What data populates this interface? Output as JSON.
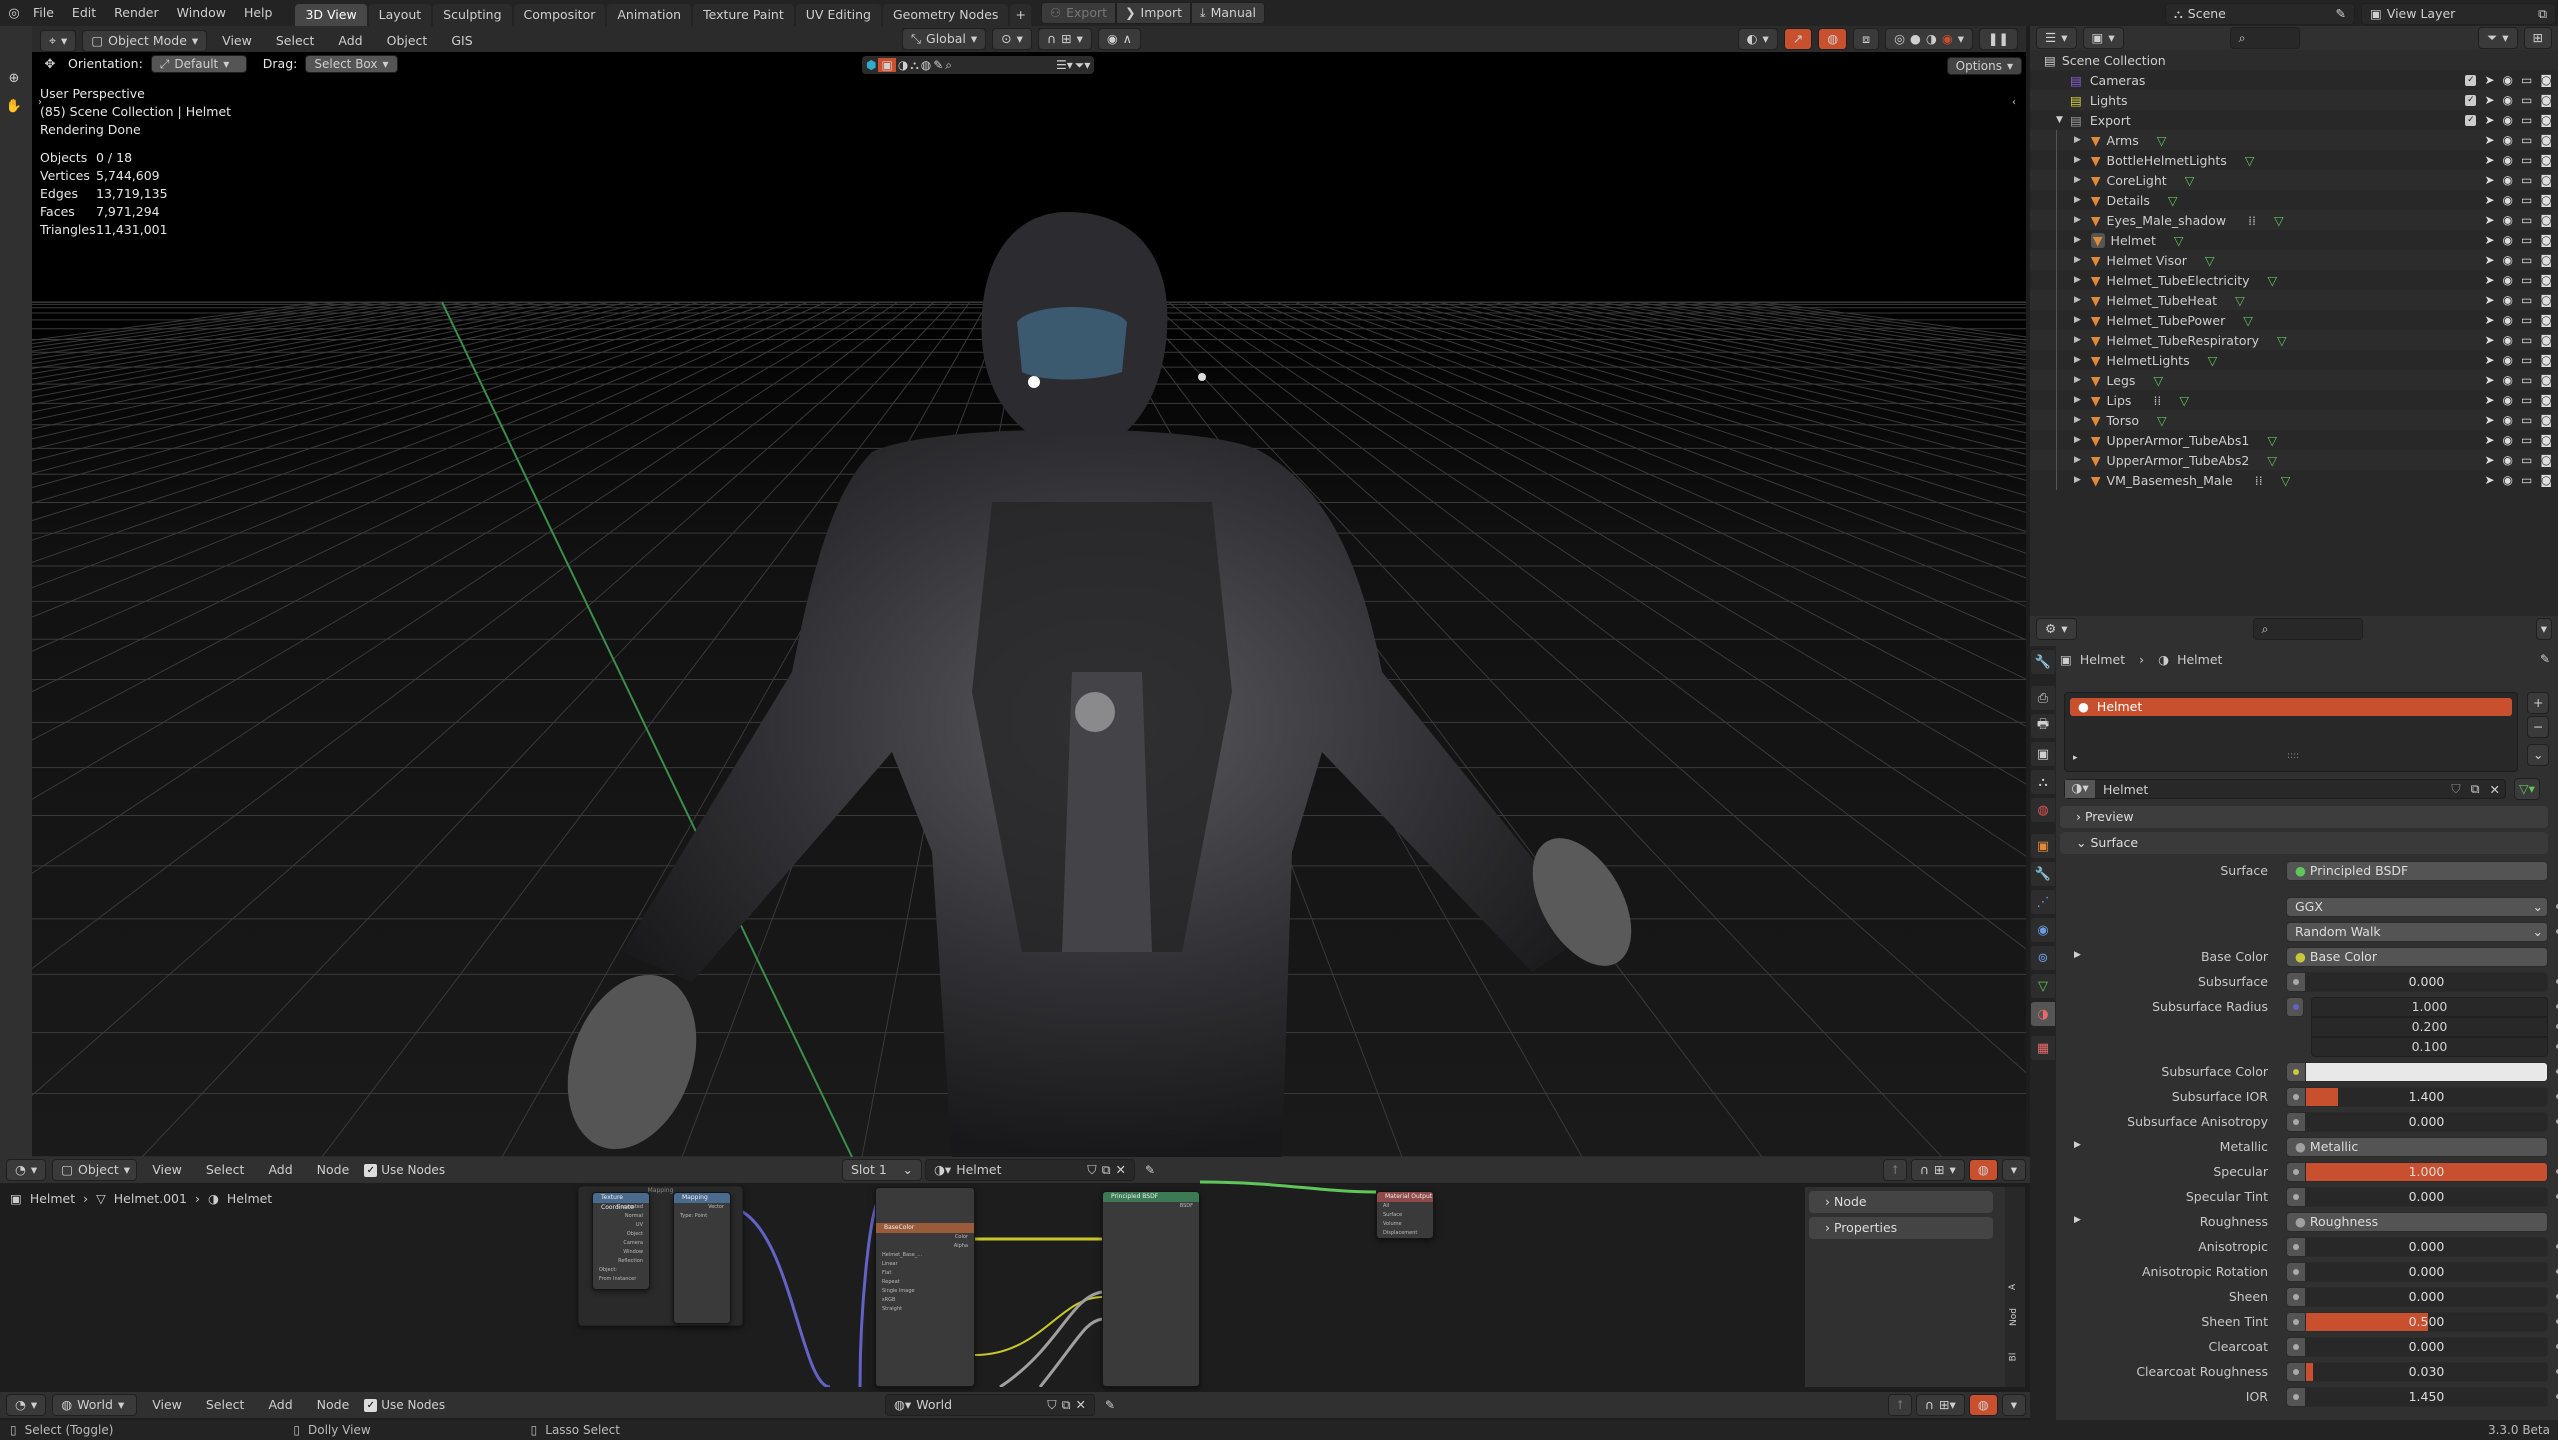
{
  "topbar": {
    "menus": [
      "File",
      "Edit",
      "Render",
      "Window",
      "Help"
    ],
    "workspaces": [
      "3D View",
      "Layout",
      "Sculpting",
      "Compositor",
      "Animation",
      "Texture Paint",
      "UV Editing",
      "Geometry Nodes"
    ],
    "active_workspace": "3D View",
    "add_tab": "+",
    "export_label": "Export",
    "import_label": "Import",
    "manual_label": "Manual",
    "scene_label": "Scene",
    "view_layer_label": "View Layer"
  },
  "viewport_header": {
    "mode": "Object Mode",
    "menus": [
      "View",
      "Select",
      "Add",
      "Object",
      "GIS"
    ],
    "transform_orientation": "Global",
    "orientation_label": "Orientation:",
    "orientation_value": "Default",
    "drag_label": "Drag:",
    "drag_value": "Select Box",
    "options_label": "Options"
  },
  "viewport": {
    "view_name": "User Perspective",
    "collection_info": "(85) Scene Collection | Helmet",
    "render_status": "Rendering Done",
    "stats": [
      {
        "label": "Objects",
        "value": "0 / 18"
      },
      {
        "label": "Vertices",
        "value": "5,744,609"
      },
      {
        "label": "Edges",
        "value": "13,719,135"
      },
      {
        "label": "Faces",
        "value": "7,971,294"
      },
      {
        "label": "Triangles",
        "value": "11,431,001"
      }
    ]
  },
  "outliner": {
    "root": "Scene Collection",
    "collections": [
      {
        "name": "Cameras",
        "color": "#8a5cd6"
      },
      {
        "name": "Lights",
        "color": "#d8d03a"
      },
      {
        "name": "Export",
        "color": "#9a9a9a"
      }
    ],
    "objects": [
      {
        "name": "Arms",
        "extra": false
      },
      {
        "name": "BottleHelmetLights",
        "extra": false
      },
      {
        "name": "CoreLight",
        "extra": false
      },
      {
        "name": "Details",
        "extra": false
      },
      {
        "name": "Eyes_Male_shadow",
        "extra": true
      },
      {
        "name": "Helmet",
        "extra": false,
        "active": true
      },
      {
        "name": "Helmet Visor",
        "extra": false
      },
      {
        "name": "Helmet_TubeElectricity",
        "extra": false
      },
      {
        "name": "Helmet_TubeHeat",
        "extra": false
      },
      {
        "name": "Helmet_TubePower",
        "extra": false
      },
      {
        "name": "Helmet_TubeRespiratory",
        "extra": false
      },
      {
        "name": "HelmetLights",
        "extra": false
      },
      {
        "name": "Legs",
        "extra": false
      },
      {
        "name": "Lips",
        "extra": true
      },
      {
        "name": "Torso",
        "extra": false
      },
      {
        "name": "UpperArmor_TubeAbs1",
        "extra": false
      },
      {
        "name": "UpperArmor_TubeAbs2",
        "extra": false
      },
      {
        "name": "VM_Basemesh_Male",
        "extra": true
      }
    ]
  },
  "properties": {
    "breadcrumb_object": "Helmet",
    "breadcrumb_material": "Helmet",
    "material_slot": "Helmet",
    "material_name": "Helmet",
    "panels": {
      "preview": "Preview",
      "surface": "Surface"
    },
    "surface_label": "Surface",
    "surface_value": "Principled BSDF",
    "distribution": "GGX",
    "subsurface_method": "Random Walk",
    "fields": [
      {
        "label": "Base Color",
        "type": "link",
        "value": "Base Color",
        "socket": "#c8c83a"
      },
      {
        "label": "Subsurface",
        "type": "slider",
        "value": "0.000",
        "fraction": 0
      },
      {
        "label": "Subsurface Radius",
        "type": "vector",
        "values": [
          "1.000",
          "0.200",
          "0.100"
        ]
      },
      {
        "label": "Subsurface Color",
        "type": "color",
        "color": "#e8e8e8"
      },
      {
        "label": "Subsurface IOR",
        "type": "slider",
        "value": "1.400",
        "fraction": 0.13
      },
      {
        "label": "Subsurface Anisotropy",
        "type": "slider",
        "value": "0.000",
        "fraction": 0
      },
      {
        "label": "Metallic",
        "type": "link",
        "value": "Metallic",
        "socket": "#a0a0a0"
      },
      {
        "label": "Specular",
        "type": "slider",
        "value": "1.000",
        "fraction": 1
      },
      {
        "label": "Specular Tint",
        "type": "slider",
        "value": "0.000",
        "fraction": 0
      },
      {
        "label": "Roughness",
        "type": "link",
        "value": "Roughness",
        "socket": "#a0a0a0"
      },
      {
        "label": "Anisotropic",
        "type": "slider",
        "value": "0.000",
        "fraction": 0
      },
      {
        "label": "Anisotropic Rotation",
        "type": "slider",
        "value": "0.000",
        "fraction": 0
      },
      {
        "label": "Sheen",
        "type": "slider",
        "value": "0.000",
        "fraction": 0
      },
      {
        "label": "Sheen Tint",
        "type": "slider",
        "value": "0.500",
        "fraction": 0.5
      },
      {
        "label": "Clearcoat",
        "type": "slider",
        "value": "0.000",
        "fraction": 0
      },
      {
        "label": "Clearcoat Roughness",
        "type": "slider",
        "value": "0.030",
        "fraction": 0.03
      },
      {
        "label": "IOR",
        "type": "slider",
        "value": "1.450",
        "fraction": 0
      }
    ]
  },
  "node_editor": {
    "type_value": "Object",
    "menus": [
      "View",
      "Select",
      "Add",
      "Node"
    ],
    "use_nodes_label": "Use Nodes",
    "slot": "Slot 1",
    "material": "Helmet",
    "breadcrumb": [
      "Helmet",
      "Helmet.001",
      "Helmet"
    ],
    "sidebar_panels": [
      "Node",
      "Properties"
    ],
    "sidebar_tabs": [
      "A",
      "Nod",
      "Bl"
    ],
    "nodes": {
      "texcoord": {
        "title": "Texture Coordinate",
        "outputs": [
          "Generated",
          "Normal",
          "UV",
          "Object",
          "Camera",
          "Window",
          "Reflection"
        ],
        "object_label": "Object:",
        "from_instancer": "From Instancer"
      },
      "mapping": {
        "title": "Mapping",
        "output": "Vector",
        "type_label": "Type:",
        "type_value": "Point",
        "inputs": [
          "Vector",
          "Location",
          "Rotation",
          "Scale"
        ]
      },
      "frame_label": "Mapping",
      "base_color": {
        "title": "BaseColor",
        "outputs": [
          "Color",
          "Alpha"
        ],
        "image": "Helmet_Base_...",
        "interp": "Linear",
        "proj": "Flat",
        "ext": "Repeat",
        "source": "Single Image",
        "colorspace": "sRGB",
        "alpha": "Straight"
      },
      "bsdf": {
        "title": "Principled BSDF",
        "output": "BSDF"
      },
      "output": {
        "title": "Material Output",
        "target": "All",
        "inputs": [
          "Surface",
          "Volume",
          "Displacement"
        ]
      }
    }
  },
  "world_editor": {
    "type_value": "World",
    "menus": [
      "View",
      "Select",
      "Add",
      "Node"
    ],
    "use_nodes_label": "Use Nodes",
    "world": "World"
  },
  "status_bar": {
    "hints": [
      "Select (Toggle)",
      "Dolly View",
      "Lasso Select"
    ],
    "version": "3.3.0 Beta"
  },
  "colors": {
    "accent": "#c9502f",
    "selection": "#c9502f",
    "bsdf_link": "#5fc75a",
    "vector_link": "#6363c7",
    "color_link": "#c7c729"
  }
}
